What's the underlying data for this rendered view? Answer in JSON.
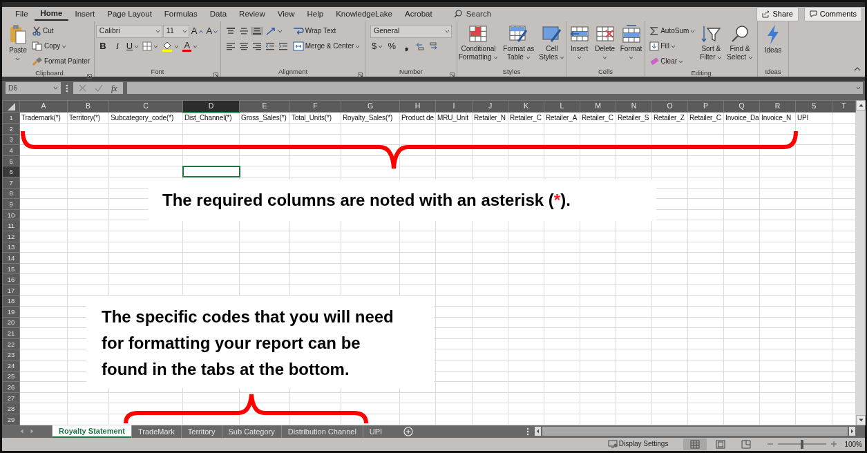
{
  "menu": {
    "tabs": [
      {
        "label": "File",
        "selected": false
      },
      {
        "label": "Home",
        "selected": true
      },
      {
        "label": "Insert",
        "selected": false
      },
      {
        "label": "Page Layout",
        "selected": false
      },
      {
        "label": "Formulas",
        "selected": false
      },
      {
        "label": "Data",
        "selected": false
      },
      {
        "label": "Review",
        "selected": false
      },
      {
        "label": "View",
        "selected": false
      },
      {
        "label": "Help",
        "selected": false
      },
      {
        "label": "KnowledgeLake",
        "selected": false
      },
      {
        "label": "Acrobat",
        "selected": false
      }
    ],
    "search": "Search",
    "share": "Share",
    "comments": "Comments"
  },
  "ribbon": {
    "groups": [
      {
        "label": "Clipboard",
        "launcher": true,
        "columns": [
          [
            [
              {
                "kind": "large",
                "lines": [
                  "Paste"
                ],
                "dropdown": true
              }
            ]
          ],
          [
            [
              {
                "kind": "small",
                "label": "Cut",
                "dropdown": false
              }
            ],
            [
              {
                "kind": "small",
                "label": "Copy",
                "dropdown": true
              }
            ],
            [
              {
                "kind": "small",
                "label": "Format Painter",
                "dropdown": false
              }
            ]
          ]
        ]
      },
      {
        "label": "Font",
        "launcher": true,
        "columns": [
          [
            [
              {
                "kind": "combo",
                "value": "Calibri"
              },
              {
                "kind": "combo",
                "value": "11"
              },
              {
                "kind": "glyph",
                "glyph": "A",
                "dropdown": false
              },
              {
                "kind": "glyph",
                "glyph": "A",
                "dropdown": false
              }
            ],
            [
              {
                "kind": "glyph",
                "glyph": "B",
                "dropdown": false
              },
              {
                "kind": "glyph",
                "glyph": "I",
                "dropdown": false
              },
              {
                "kind": "glyph",
                "glyph": "U",
                "dropdown": true
              },
              {
                "kind": "icon",
                "dropdown": true
              },
              {
                "kind": "icon",
                "dropdown": true
              },
              {
                "kind": "glyph",
                "glyph": "A",
                "dropdown": true
              }
            ]
          ]
        ]
      },
      {
        "label": "Alignment",
        "launcher": true,
        "columns": [
          [
            [
              {
                "kind": "icon",
                "dropdown": false,
                "pressed": false
              },
              {
                "kind": "icon",
                "dropdown": false,
                "pressed": false
              },
              {
                "kind": "icon",
                "dropdown": false,
                "pressed": true
              },
              {
                "kind": "icon",
                "dropdown": true,
                "pressed": false
              }
            ],
            [
              {
                "kind": "icon",
                "dropdown": false,
                "pressed": false
              },
              {
                "kind": "icon",
                "dropdown": false,
                "pressed": false
              },
              {
                "kind": "icon",
                "dropdown": false,
                "pressed": false
              },
              {
                "kind": "icon",
                "dropdown": false,
                "pressed": false
              },
              {
                "kind": "icon",
                "dropdown": false,
                "pressed": false
              }
            ]
          ],
          [
            [
              {
                "kind": "small",
                "label": "Wrap Text",
                "dropdown": false
              }
            ],
            [
              {
                "kind": "small",
                "label": "Merge & Center",
                "dropdown": true
              }
            ]
          ]
        ]
      },
      {
        "label": "Number",
        "launcher": true,
        "columns": [
          [
            [
              {
                "kind": "combo",
                "value": "General"
              }
            ],
            [
              {
                "kind": "glyph",
                "glyph": "$",
                "dropdown": true
              },
              {
                "kind": "glyph",
                "glyph": "%",
                "dropdown": false
              },
              {
                "kind": "glyph",
                "glyph": "❟",
                "dropdown": false
              },
              {
                "kind": "icon",
                "dropdown": false
              },
              {
                "kind": "icon",
                "dropdown": false
              }
            ]
          ]
        ]
      },
      {
        "label": "Styles",
        "launcher": false,
        "columns": [
          [
            [
              {
                "kind": "large",
                "lines": [
                  "Conditional",
                  "Formatting"
                ],
                "dropdown": true
              }
            ]
          ],
          [
            [
              {
                "kind": "large",
                "lines": [
                  "Format as",
                  "Table"
                ],
                "dropdown": true
              }
            ]
          ],
          [
            [
              {
                "kind": "large",
                "lines": [
                  "Cell",
                  "Styles"
                ],
                "dropdown": true
              }
            ]
          ]
        ]
      },
      {
        "label": "Cells",
        "launcher": false,
        "columns": [
          [
            [
              {
                "kind": "large",
                "lines": [
                  "Insert"
                ],
                "dropdown": true
              }
            ]
          ],
          [
            [
              {
                "kind": "large",
                "lines": [
                  "Delete"
                ],
                "dropdown": true
              }
            ]
          ],
          [
            [
              {
                "kind": "large",
                "lines": [
                  "Format"
                ],
                "dropdown": true
              }
            ]
          ]
        ]
      },
      {
        "label": "Editing",
        "launcher": false,
        "columns": [
          [
            [
              {
                "kind": "small",
                "label": "AutoSum",
                "dropdown": true
              }
            ],
            [
              {
                "kind": "small",
                "label": "Fill",
                "dropdown": true
              }
            ],
            [
              {
                "kind": "small",
                "label": "Clear",
                "dropdown": true
              }
            ]
          ],
          [
            [
              {
                "kind": "large",
                "lines": [
                  "Sort &",
                  "Filter"
                ],
                "dropdown": true
              }
            ]
          ],
          [
            [
              {
                "kind": "large",
                "lines": [
                  "Find &",
                  "Select"
                ],
                "dropdown": true
              }
            ]
          ]
        ]
      },
      {
        "label": "Ideas",
        "launcher": false,
        "columns": [
          [
            [
              {
                "kind": "large",
                "lines": [
                  "Ideas"
                ],
                "dropdown": false
              }
            ]
          ]
        ]
      }
    ]
  },
  "formula_bar": {
    "name_box": "D6",
    "function_label": "fx"
  },
  "sheet": {
    "columns": [
      {
        "letter": "A",
        "header": "Trademark(*)",
        "selected": false
      },
      {
        "letter": "B",
        "header": "Territory(*)",
        "selected": false
      },
      {
        "letter": "C",
        "header": "Subcategory_code(*)",
        "selected": false
      },
      {
        "letter": "D",
        "header": "Dist_Channel(*)",
        "selected": true
      },
      {
        "letter": "E",
        "header": "Gross_Sales(*)",
        "selected": false
      },
      {
        "letter": "F",
        "header": "Total_Units(*)",
        "selected": false
      },
      {
        "letter": "G",
        "header": "Royalty_Sales(*)",
        "selected": false
      },
      {
        "letter": "H",
        "header": "Product de",
        "selected": false
      },
      {
        "letter": "I",
        "header": "MRU_Unit",
        "selected": false
      },
      {
        "letter": "J",
        "header": "Retailer_N",
        "selected": false
      },
      {
        "letter": "K",
        "header": "Retailer_C",
        "selected": false
      },
      {
        "letter": "L",
        "header": "Retailer_A",
        "selected": false
      },
      {
        "letter": "M",
        "header": "Retailer_C",
        "selected": false
      },
      {
        "letter": "N",
        "header": "Retailer_S",
        "selected": false
      },
      {
        "letter": "O",
        "header": "Retailer_Z",
        "selected": false
      },
      {
        "letter": "P",
        "header": "Retailer_C",
        "selected": false
      },
      {
        "letter": "Q",
        "header": "Invoice_Da",
        "selected": false
      },
      {
        "letter": "R",
        "header": "Invoice_N",
        "selected": false
      },
      {
        "letter": "S",
        "header": "UPI",
        "selected": false
      },
      {
        "letter": "T",
        "selected": false
      }
    ],
    "rows": [
      {
        "number": "1",
        "selected": false
      },
      {
        "number": "2",
        "selected": false
      },
      {
        "number": "3",
        "selected": false
      },
      {
        "number": "4",
        "selected": false
      },
      {
        "number": "5",
        "selected": false
      },
      {
        "number": "6",
        "selected": true
      },
      {
        "number": "7",
        "selected": false
      },
      {
        "number": "8",
        "selected": false
      },
      {
        "number": "9",
        "selected": false
      },
      {
        "number": "10",
        "selected": false
      },
      {
        "number": "11",
        "selected": false
      },
      {
        "number": "12",
        "selected": false
      },
      {
        "number": "13",
        "selected": false
      },
      {
        "number": "14",
        "selected": false
      },
      {
        "number": "15",
        "selected": false
      },
      {
        "number": "16",
        "selected": false
      },
      {
        "number": "17",
        "selected": false
      },
      {
        "number": "18",
        "selected": false
      },
      {
        "number": "19",
        "selected": false
      },
      {
        "number": "20",
        "selected": false
      },
      {
        "number": "21",
        "selected": false
      },
      {
        "number": "22",
        "selected": false
      },
      {
        "number": "23",
        "selected": false
      },
      {
        "number": "24",
        "selected": false
      },
      {
        "number": "25",
        "selected": false
      },
      {
        "number": "26",
        "selected": false
      },
      {
        "number": "27",
        "selected": false
      },
      {
        "number": "28",
        "selected": false
      },
      {
        "number": "29",
        "selected": false
      }
    ]
  },
  "sheet_tabs": [
    {
      "label": "Royalty Statement",
      "selected": true
    },
    {
      "label": "TradeMark",
      "selected": false
    },
    {
      "label": "Territory",
      "selected": false
    },
    {
      "label": "Sub Category",
      "selected": false
    },
    {
      "label": "Distribution Channel",
      "selected": false
    },
    {
      "label": "UPI",
      "selected": false
    }
  ],
  "status_bar": {
    "display_settings": "Display Settings",
    "views": [
      {
        "selected": true
      },
      {
        "selected": false
      },
      {
        "selected": false
      }
    ],
    "zoom": {
      "level": 0.5,
      "reading": "100%"
    }
  },
  "callouts": [
    {
      "segments": [
        {
          "text": "The required columns are noted with an asterisk (",
          "emphasis": false
        },
        {
          "text": "*",
          "emphasis": true
        },
        {
          "text": ").",
          "emphasis": false
        }
      ]
    },
    {
      "segments": [
        {
          "text": "The specific codes that you will need for formatting your report can be found in the tabs at the bottom.",
          "emphasis": false
        }
      ]
    }
  ]
}
